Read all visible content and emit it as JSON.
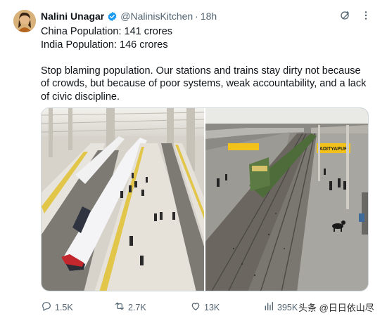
{
  "tweet": {
    "author": {
      "name": "Nalini Unagar",
      "handle": "@NalinisKitchen",
      "time": "18h",
      "verified": true
    },
    "text_lines": [
      "China Population: 141 crores",
      "India Population: 146 crores"
    ],
    "paragraph": "Stop blaming population. Our stations and trains stay dirty not because of crowds, but because of poor systems, weak accountability, and a lack of civic discipline.",
    "media": [
      {
        "icon": "photo-china-station"
      },
      {
        "icon": "photo-india-station",
        "sign_text": "ADITYAPUR"
      }
    ],
    "stats": {
      "replies": "1.5K",
      "reposts": "2.7K",
      "likes": "13K",
      "views": "395K"
    }
  },
  "watermark": "头条 @日日依山尽",
  "colors": {
    "accent": "#1d9bf0",
    "text": "#0f1419",
    "muted": "#536471"
  }
}
